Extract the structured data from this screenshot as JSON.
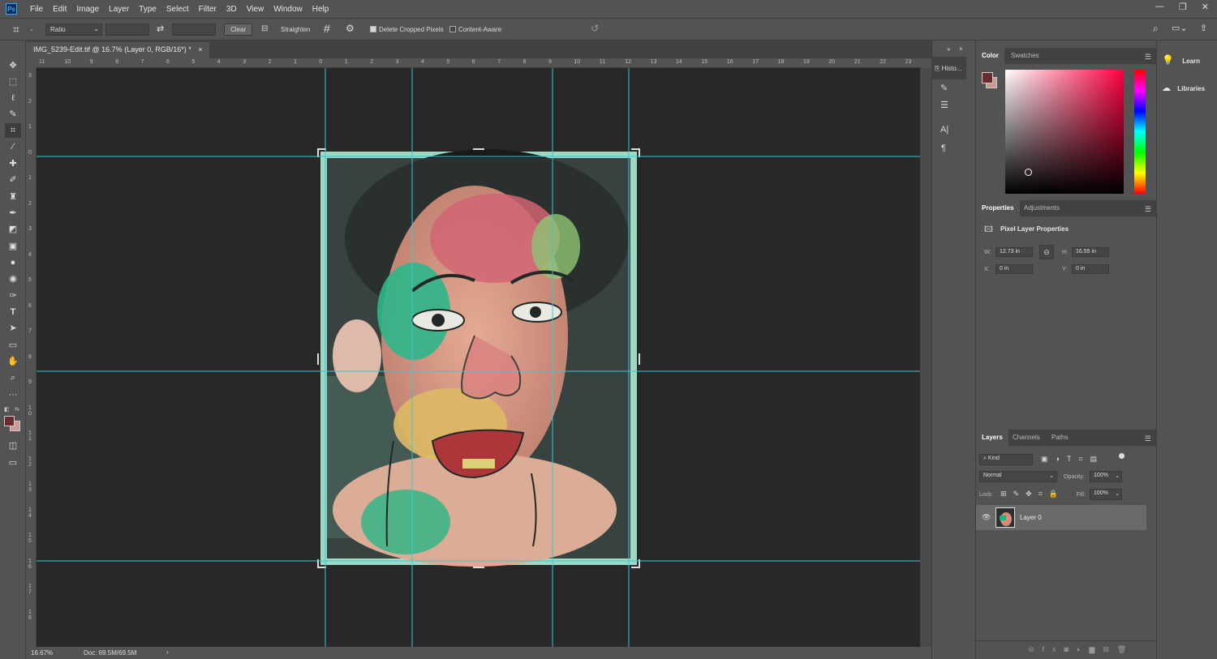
{
  "app": {
    "logo": "Ps"
  },
  "menu": [
    "File",
    "Edit",
    "Image",
    "Layer",
    "Type",
    "Select",
    "Filter",
    "3D",
    "View",
    "Window",
    "Help"
  ],
  "window_controls": [
    "minimize-icon",
    "restore-icon",
    "close-icon"
  ],
  "options": {
    "ratio_select": "Ratio",
    "clear_label": "Clear",
    "straighten_label": "Straighten",
    "delete_cropped_label": "Delete Cropped Pixels",
    "delete_cropped_checked": true,
    "content_aware_label": "Content-Aware",
    "content_aware_checked": false
  },
  "document": {
    "tab_title": "IMG_5239-Edit.tif @ 16.7% (Layer 0, RGB/16*) *",
    "close": "×"
  },
  "ruler": {
    "h_ticks": [
      "11",
      "10",
      "9",
      "8",
      "7",
      "6",
      "5",
      "4",
      "3",
      "2",
      "1",
      "0",
      "1",
      "2",
      "3",
      "4",
      "5",
      "6",
      "7",
      "8",
      "9",
      "10",
      "11",
      "12",
      "13",
      "14",
      "15",
      "16",
      "17",
      "18",
      "19",
      "20",
      "21",
      "22",
      "23"
    ],
    "v_ticks": [
      "3",
      "2",
      "1",
      "0",
      "1",
      "2",
      "3",
      "4",
      "5",
      "6",
      "7",
      "8",
      "9",
      "1 0",
      "1 1",
      "1 2",
      "1 3",
      "1 4",
      "1 5",
      "1 6",
      "1 7",
      "1 8"
    ]
  },
  "status": {
    "zoom": "16.67%",
    "doc": "Doc: 69.5M/69.5M"
  },
  "mid_panel": {
    "history_label": "Histo..."
  },
  "color_panel": {
    "tabs": [
      "Color",
      "Swatches"
    ],
    "foreground": "#6a2a2e",
    "background": "#c79a94",
    "hue": "#ff0040"
  },
  "properties_panel": {
    "tabs": [
      "Properties",
      "Adjustments"
    ],
    "title": "Pixel Layer Properties",
    "w_label": "W:",
    "w_value": "12.73 in",
    "h_label": "H:",
    "h_value": "16.55 in",
    "x_label": "X:",
    "x_value": "0 in",
    "y_label": "Y:",
    "y_value": "0 in"
  },
  "layers_panel": {
    "tabs": [
      "Layers",
      "Channels",
      "Paths"
    ],
    "kind_label": "Kind",
    "blend_mode": "Normal",
    "opacity_label": "Opacity:",
    "opacity_value": "100%",
    "lock_label": "Lock:",
    "fill_label": "Fill:",
    "fill_value": "100%",
    "layers": [
      {
        "name": "Layer 0",
        "visible": true
      }
    ]
  },
  "far_panel": {
    "learn": "Learn",
    "libraries": "Libraries"
  },
  "colors": {
    "guide": "#36c9d6",
    "canvas_bg": "#282828",
    "selection_tint": "#9fd8c0"
  }
}
